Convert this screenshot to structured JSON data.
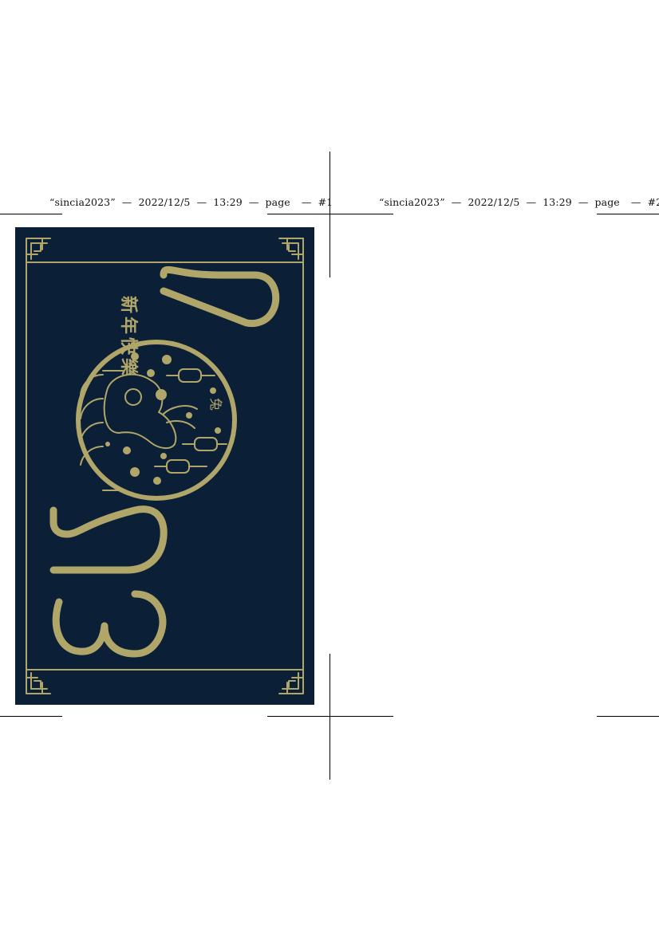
{
  "pages": [
    {
      "header": {
        "file": "“sincia2023”",
        "date": "2022/12/5",
        "time": "13:29",
        "page_word": "page",
        "page_number": "#1"
      }
    },
    {
      "header": {
        "file": "“sincia2023”",
        "date": "2022/12/5",
        "time": "13:29",
        "page_word": "page",
        "page_number": "#2"
      }
    }
  ],
  "separator": "—",
  "card": {
    "blessing": "新年快樂",
    "zodiac_char": "兔",
    "year_digits": [
      "2",
      "0",
      "2",
      "3"
    ],
    "colors": {
      "background": "#0b1f36",
      "gold": "#b1a66a"
    }
  }
}
